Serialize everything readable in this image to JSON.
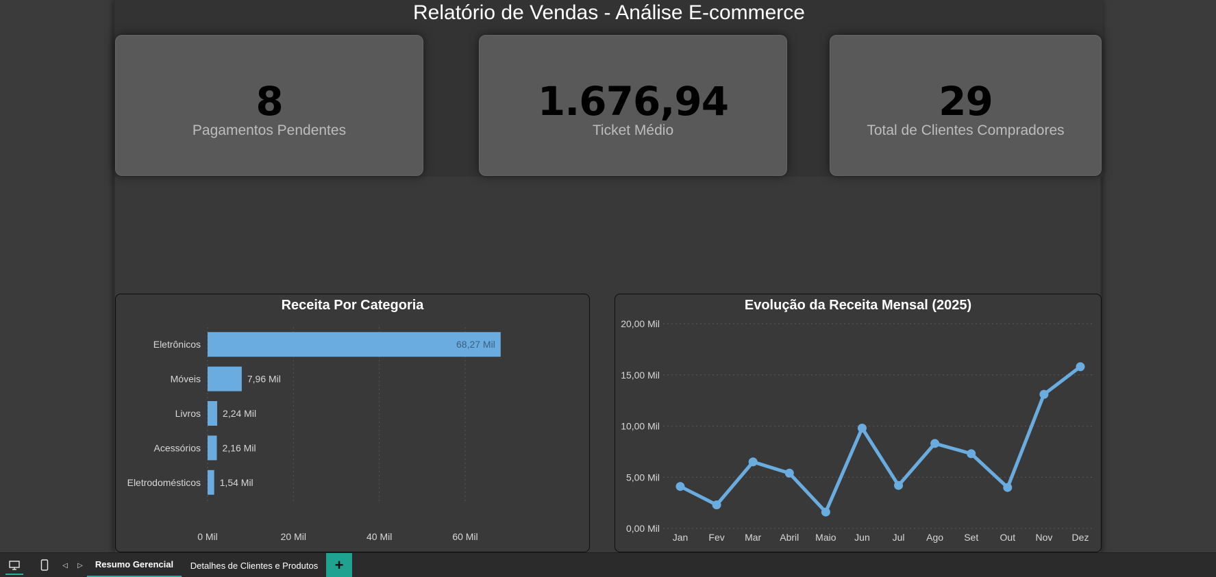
{
  "report": {
    "title": "Relatório de Vendas - Análise E-commerce"
  },
  "kpis": [
    {
      "value": "8",
      "label": "Pagamentos Pendentes"
    },
    {
      "value": "1.676,94",
      "label": "Ticket Médio"
    },
    {
      "value": "29",
      "label": "Total de Clientes Compradores"
    }
  ],
  "tabs": {
    "active": "Resumo Gerencial",
    "second": "Detalhes de Clientes e Produtos",
    "add": "+"
  },
  "colors": {
    "accent": "#6aacdf",
    "tab_accent": "#1fb3a0"
  },
  "icons": [
    "desktop-icon",
    "phone-icon",
    "chevron-left-icon",
    "chevron-right-icon",
    "plus-icon"
  ],
  "chart_data": [
    {
      "type": "bar",
      "orientation": "horizontal",
      "title": "Receita Por Categoria",
      "categories": [
        "Eletrônicos",
        "Móveis",
        "Livros",
        "Acessórios",
        "Eletrodomésticos"
      ],
      "values": [
        68.27,
        7.96,
        2.24,
        2.16,
        1.54
      ],
      "value_labels": [
        "68,27 Mil",
        "7,96 Mil",
        "2,24 Mil",
        "2,16 Mil",
        "1,54 Mil"
      ],
      "xlim": [
        0,
        75
      ],
      "xticks": [
        0,
        20,
        40,
        60
      ],
      "xtick_labels": [
        "0 Mil",
        "20 Mil",
        "40 Mil",
        "60 Mil"
      ],
      "grid": true
    },
    {
      "type": "line",
      "title": "Evolução da Receita Mensal (2025)",
      "categories": [
        "Jan",
        "Fev",
        "Mar",
        "Abril",
        "Maio",
        "Jun",
        "Jul",
        "Ago",
        "Set",
        "Out",
        "Nov",
        "Dez"
      ],
      "values": [
        4.1,
        2.3,
        6.5,
        5.4,
        1.6,
        9.8,
        4.2,
        8.3,
        7.3,
        4.0,
        13.1,
        15.8
      ],
      "ylim": [
        0,
        20
      ],
      "yticks": [
        0,
        5,
        10,
        15,
        20
      ],
      "ytick_labels": [
        "0,00 Mil",
        "5,00 Mil",
        "10,00 Mil",
        "15,00 Mil",
        "20,00 Mil"
      ],
      "grid": true
    }
  ]
}
